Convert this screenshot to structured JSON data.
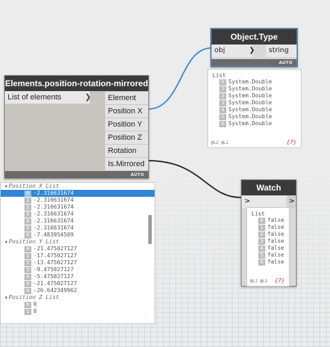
{
  "elements_node": {
    "title": "Elements.position-rotation-mirrored",
    "input": "List of elements",
    "outputs": [
      "Element",
      "Position X",
      "Position Y",
      "Position Z",
      "Rotation",
      "Is.Mirrored"
    ],
    "badge": "AUTO"
  },
  "objtype_node": {
    "title": "Object.Type",
    "input": "obj",
    "output": "string",
    "badge": "AUTO"
  },
  "objtype_preview": {
    "header": "List",
    "items": [
      {
        "i": "0",
        "v": "System.Double"
      },
      {
        "i": "1",
        "v": "System.Double"
      },
      {
        "i": "2",
        "v": "System.Double"
      },
      {
        "i": "3",
        "v": "System.Double"
      },
      {
        "i": "4",
        "v": "System.Double"
      },
      {
        "i": "5",
        "v": "System.Double"
      },
      {
        "i": "6",
        "v": "System.Double"
      }
    ],
    "levels": "@L2 @L1",
    "count": "{7}"
  },
  "watch_node": {
    "title": "Watch",
    "input": ">",
    "output": ">",
    "header": "List",
    "items": [
      {
        "i": "0",
        "v": "false"
      },
      {
        "i": "1",
        "v": "false"
      },
      {
        "i": "2",
        "v": "false"
      },
      {
        "i": "3",
        "v": "false"
      },
      {
        "i": "4",
        "v": "false"
      },
      {
        "i": "5",
        "v": "false"
      },
      {
        "i": "6",
        "v": "false"
      }
    ],
    "levels": "@L2 @L1",
    "count": "{7}"
  },
  "elements_preview": {
    "position_x": {
      "label": "Position X List",
      "items": [
        {
          "i": "0",
          "v": "-2.316631674"
        },
        {
          "i": "1",
          "v": "-2.316631674"
        },
        {
          "i": "2",
          "v": "-2.316631674"
        },
        {
          "i": "3",
          "v": "-2.316631674"
        },
        {
          "i": "4",
          "v": "-2.316631674"
        },
        {
          "i": "5",
          "v": "-2.316631674"
        },
        {
          "i": "6",
          "v": "-7.483954509"
        }
      ]
    },
    "position_y": {
      "label": "Position Y List",
      "items": [
        {
          "i": "0",
          "v": "-21.475027127"
        },
        {
          "i": "1",
          "v": "-17.475027127"
        },
        {
          "i": "2",
          "v": "-13.475027127"
        },
        {
          "i": "3",
          "v": "-9.475027127"
        },
        {
          "i": "4",
          "v": "-5.475027127"
        },
        {
          "i": "5",
          "v": "-21.475027127"
        },
        {
          "i": "6",
          "v": "-26.642349962"
        }
      ]
    },
    "position_z": {
      "label": "Position Z List",
      "items": [
        {
          "i": "0",
          "v": "0"
        },
        {
          "i": "1",
          "v": "0"
        }
      ]
    }
  }
}
